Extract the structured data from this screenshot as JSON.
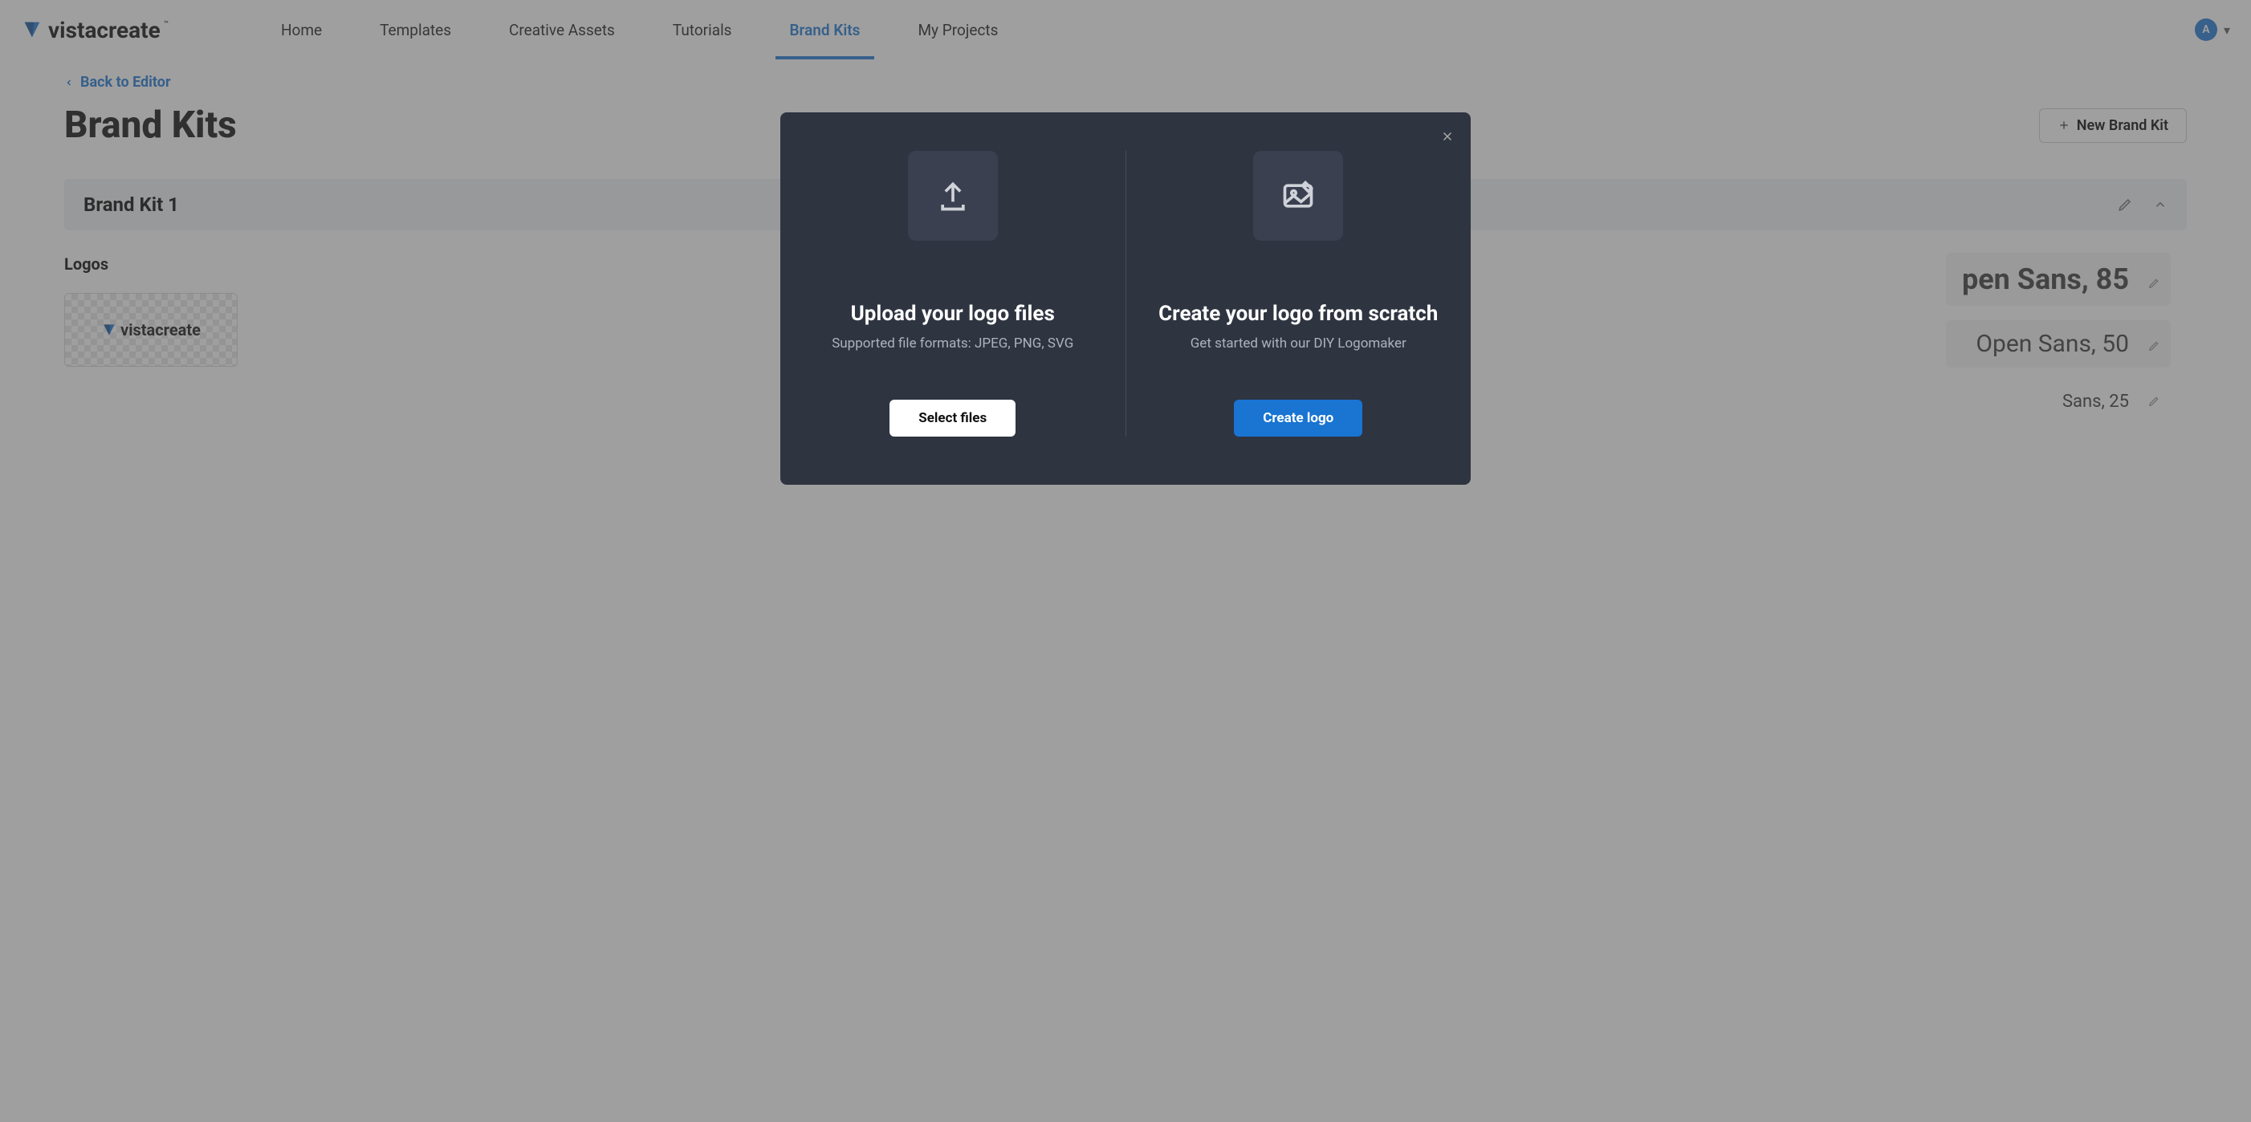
{
  "brand": {
    "name": "vistacreate"
  },
  "nav": {
    "items": [
      "Home",
      "Templates",
      "Creative Assets",
      "Tutorials",
      "Brand Kits",
      "My Projects"
    ],
    "active_index": 4
  },
  "avatar": {
    "initial": "A"
  },
  "back_link": "Back to Editor",
  "page_title": "Brand Kits",
  "new_button": "New Brand Kit",
  "kit": {
    "name": "Brand Kit 1"
  },
  "logos_heading": "Logos",
  "logo_thumb_text": "vistacreate",
  "font_samples": [
    {
      "text": "pen Sans, 85"
    },
    {
      "text": "Open Sans, 50"
    },
    {
      "text": "Sans, 25"
    }
  ],
  "modal": {
    "upload": {
      "title": "Upload your logo files",
      "subtitle": "Supported file formats: JPEG, PNG, SVG",
      "button": "Select files"
    },
    "create": {
      "title": "Create your logo from scratch",
      "subtitle": "Get started with our DIY Logomaker",
      "button": "Create logo"
    }
  }
}
